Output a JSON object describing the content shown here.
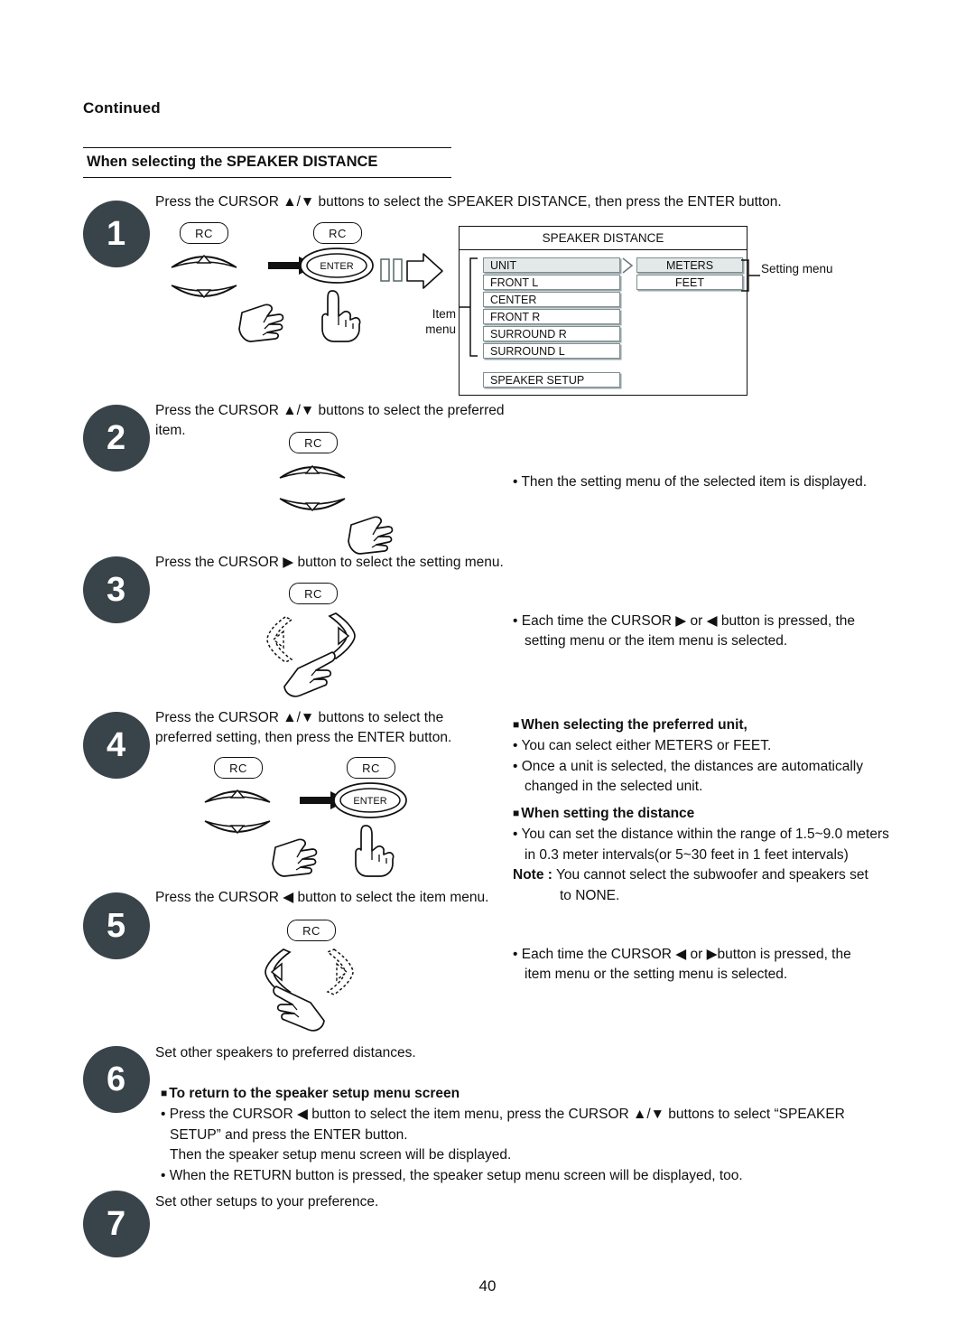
{
  "header": {
    "continued": "Continued",
    "section_title": "When selecting the SPEAKER DISTANCE"
  },
  "steps": [
    {
      "number": "1",
      "text": "Press the CURSOR ▲/▼ buttons to select the SPEAKER DISTANCE, then press the ENTER button."
    },
    {
      "number": "2",
      "text": "Press the CURSOR ▲/▼ buttons to select the preferred item."
    },
    {
      "number": "3",
      "text": "Press the CURSOR ▶ button to select the setting menu."
    },
    {
      "number": "4",
      "text": "Press the CURSOR ▲/▼ buttons to select the preferred setting, then press the ENTER button."
    },
    {
      "number": "5",
      "text": "Press the CURSOR ◀ button to select the item menu."
    },
    {
      "number": "6",
      "text": "Set other speakers to preferred distances."
    },
    {
      "number": "7",
      "text": "Set other setups to your preference."
    }
  ],
  "rc": {
    "label": "RC",
    "enter_label": "ENTER"
  },
  "osd": {
    "title": "SPEAKER DISTANCE",
    "item_menu_label_line1": "Item",
    "item_menu_label_line2": "menu",
    "setting_menu_label": "Setting menu",
    "items": [
      {
        "label": "UNIT",
        "highlighted": true
      },
      {
        "label": "FRONT L",
        "highlighted": false
      },
      {
        "label": "CENTER",
        "highlighted": false
      },
      {
        "label": "FRONT R",
        "highlighted": false
      },
      {
        "label": "SURROUND R",
        "highlighted": false
      },
      {
        "label": "SURROUND L",
        "highlighted": false
      }
    ],
    "speaker_setup": "SPEAKER SETUP",
    "settings": [
      {
        "label": "METERS",
        "highlighted": true
      },
      {
        "label": "FEET",
        "highlighted": false
      }
    ]
  },
  "notes": {
    "after_step2": "• Then the setting menu of the selected item is displayed.",
    "after_step3_line1": "• Each time the CURSOR ▶ or ◀ button is pressed, the",
    "after_step3_line2": "setting menu or the item menu is selected.",
    "unit_heading": "When selecting the preferred unit,",
    "unit_bullet1": "• You can select either METERS or FEET.",
    "unit_bullet2": "• Once a unit is selected, the distances are automatically",
    "unit_bullet2_cont": "changed in the selected unit.",
    "distance_heading": "When setting the distance",
    "distance_bullet1": "• You can set the distance within the range of 1.5~9.0 meters",
    "distance_bullet1_cont": "in 0.3 meter intervals(or 5~30 feet in 1 feet intervals)",
    "distance_note_label": "Note :",
    "distance_note_text": "You cannot select the subwoofer and speakers set",
    "distance_note_cont": "to NONE.",
    "after_step5_line1": "• Each time the CURSOR ◀ or ▶button is pressed, the",
    "after_step5_line2": "item menu or the setting menu is selected."
  },
  "return_section": {
    "heading": "To return to the speaker setup menu screen",
    "bullet1_line1": "• Press the CURSOR ◀ button to select the item menu, press the CURSOR ▲/▼ buttons to select “SPEAKER",
    "bullet1_line2": "SETUP” and press the ENTER button.",
    "bullet1_line3": "Then the speaker setup menu screen will be displayed.",
    "bullet2": "• When the RETURN button is pressed, the speaker setup menu screen will be displayed, too."
  },
  "footer": {
    "page_number": "40"
  }
}
